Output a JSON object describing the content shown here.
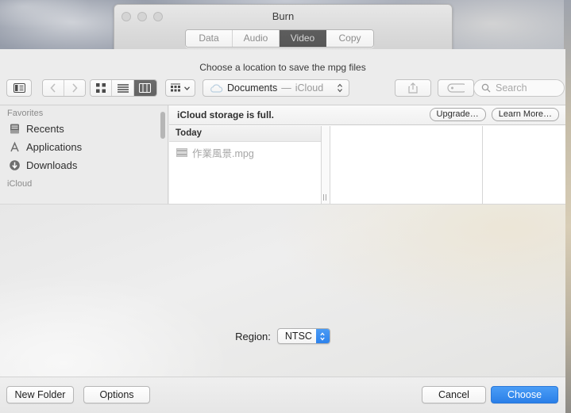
{
  "window": {
    "title": "Burn",
    "traffic_lights": [
      "close",
      "minimize",
      "zoom"
    ],
    "tabs": [
      {
        "label": "Data",
        "selected": false
      },
      {
        "label": "Audio",
        "selected": false
      },
      {
        "label": "Video",
        "selected": true
      },
      {
        "label": "Copy",
        "selected": false
      }
    ]
  },
  "sheet": {
    "prompt": "Choose a location to save the mpg files",
    "toolbar": {
      "sidebar_toggle": "sidebar-toggle-icon",
      "back": "chevron-left-icon",
      "forward": "chevron-right-icon",
      "view_icon": "icon-view-icon",
      "view_list": "list-view-icon",
      "view_column": "column-view-icon",
      "arrange": "arrange-icon",
      "path": {
        "name": "Documents",
        "separator": "—",
        "location": "iCloud"
      },
      "share": "share-icon",
      "tags": "tag-icon",
      "search_placeholder": "Search",
      "search_value": ""
    },
    "sidebar": {
      "sections": [
        {
          "header": "Favorites",
          "items": [
            {
              "label": "Recents",
              "icon": "clock-document-icon"
            },
            {
              "label": "Applications",
              "icon": "applications-icon"
            },
            {
              "label": "Downloads",
              "icon": "download-arrow-icon"
            }
          ]
        },
        {
          "header": "iCloud",
          "items": []
        }
      ]
    },
    "notice": {
      "text": "iCloud storage is full.",
      "upgrade_label": "Upgrade…",
      "learn_more_label": "Learn More…"
    },
    "columns": {
      "group_header": "Today",
      "files": [
        {
          "name": "作業風景.mpg",
          "icon": "movie-file-icon",
          "enabled": false
        }
      ]
    },
    "accessory": {
      "region_label": "Region:",
      "region_value": "NTSC"
    },
    "buttons": {
      "new_folder": "New Folder",
      "options": "Options",
      "cancel": "Cancel",
      "choose": "Choose"
    }
  },
  "colors": {
    "accent_blue": "#2a7fe8",
    "selected_segment": "#5e5e5e",
    "sheet_background": "#ececec"
  }
}
